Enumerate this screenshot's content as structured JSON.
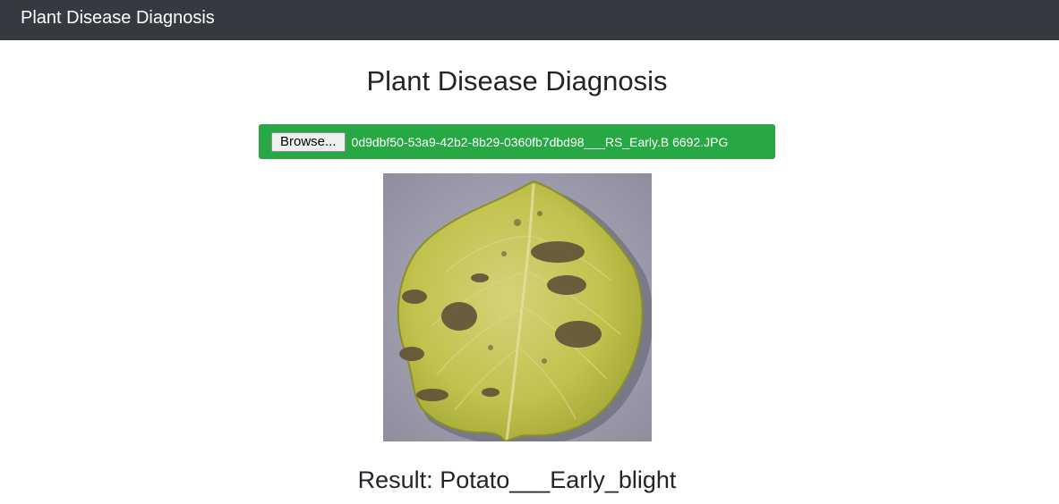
{
  "navbar": {
    "brand": "Plant Disease Diagnosis"
  },
  "main": {
    "title": "Plant Disease Diagnosis",
    "upload": {
      "button_label": "Browse...",
      "file_name": "0d9dbf50-53a9-42b2-8b29-0360fb7dbd98___RS_Early.B 6692.JPG",
      "bar_color": "#28a745"
    },
    "image": {
      "subject": "leaf-image"
    },
    "result": {
      "label": "Result:",
      "value": "Potato___Early_blight"
    }
  }
}
